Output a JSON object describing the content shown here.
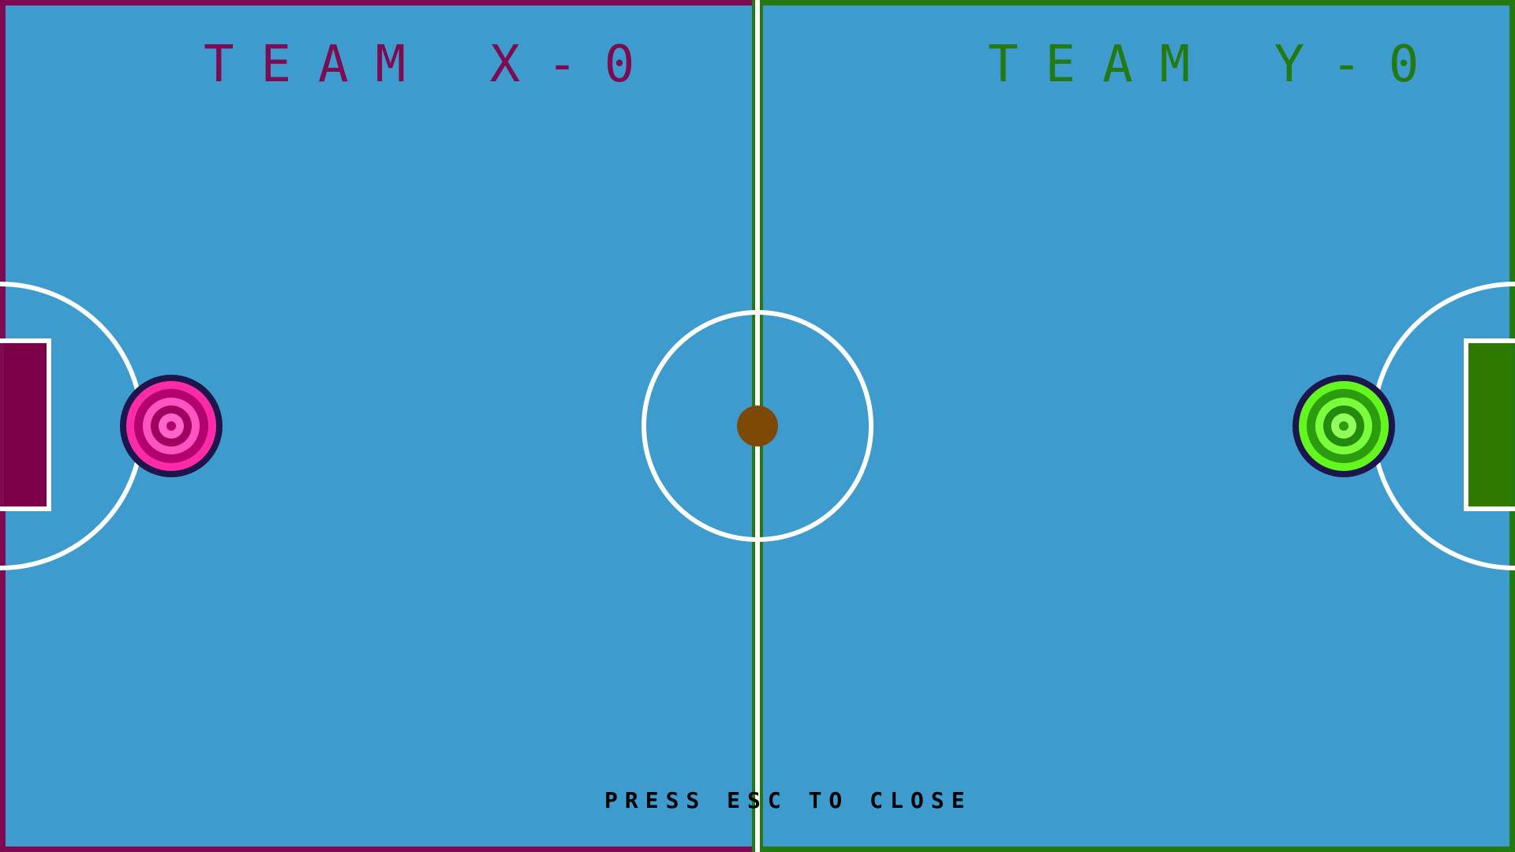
{
  "team_x": {
    "label": "TEAM X-0",
    "color": "#7e0a52",
    "goal_color": "#7b0048",
    "puck_colors": [
      "#ff2aa8",
      "#b2006e",
      "#ff55c0",
      "#a0005f",
      "#ff66cc"
    ]
  },
  "team_y": {
    "label": "TEAM Y-0",
    "color": "#247a10",
    "goal_color": "#2f7a00",
    "puck_colors": [
      "#63f71f",
      "#2a9c0d",
      "#7bff3c",
      "#228a0c",
      "#93ff5d"
    ]
  },
  "field": {
    "color": "#3d9bcd",
    "line_color": "#ffffff"
  },
  "ball": {
    "color": "#7c4a06"
  },
  "hint": {
    "text": "PRESS ESC TO CLOSE"
  }
}
